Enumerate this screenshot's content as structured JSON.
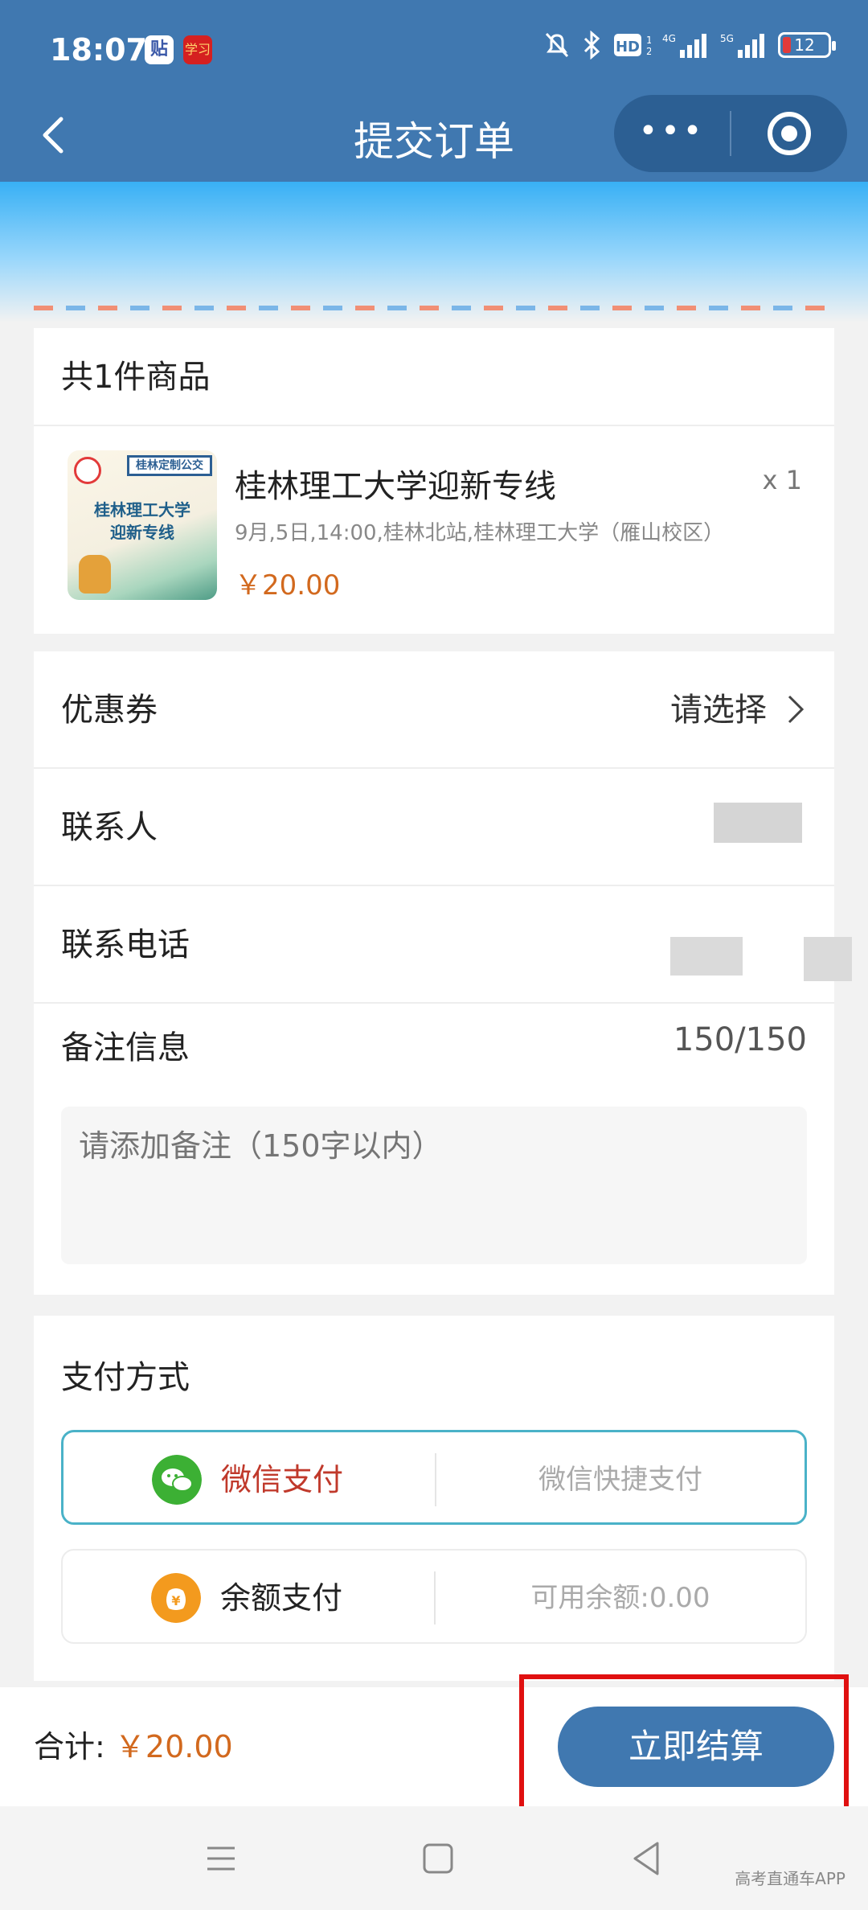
{
  "status_bar": {
    "time": "18:07",
    "app_icons": [
      "贴",
      "学习"
    ],
    "network": "5G",
    "battery": "12"
  },
  "header": {
    "title": "提交订单",
    "more_label": "•••"
  },
  "goods": {
    "heading": "共1件商品",
    "thumbnail": {
      "tag": "桂林定制公交",
      "line1": "桂林理工大学",
      "line2": "迎新专线"
    },
    "name": "桂林理工大学迎新专线",
    "quantity": "x 1",
    "description": "9月,5日,14:00,桂林北站,桂林理工大学（雁山校区）",
    "price": "￥20.00"
  },
  "form": {
    "coupon_label": "优惠券",
    "coupon_value": "请选择",
    "contact_label": "联系人",
    "phone_label": "联系电话",
    "remark_label": "备注信息",
    "remark_counter": "150/150",
    "remark_placeholder": "请添加备注（150字以内）"
  },
  "payment": {
    "title": "支付方式",
    "options": [
      {
        "name": "微信支付",
        "sub": "微信快捷支付",
        "icon": "wechat-pay-icon",
        "selected": true,
        "color": "#c0392b"
      },
      {
        "name": "余额支付",
        "sub": "可用余额:0.00",
        "icon": "balance-wallet-icon",
        "selected": false,
        "color": "#222222"
      }
    ]
  },
  "checkout": {
    "total_label": "合计: ",
    "total_value": "￥20.00",
    "button_label": "立即结算"
  },
  "watermark": "高考直通车APP",
  "colors": {
    "primary": "#4078b0",
    "price": "#d2691e",
    "wechat_green": "#3cb034",
    "balance_orange": "#f39a1e",
    "highlight_red": "#e01010"
  }
}
